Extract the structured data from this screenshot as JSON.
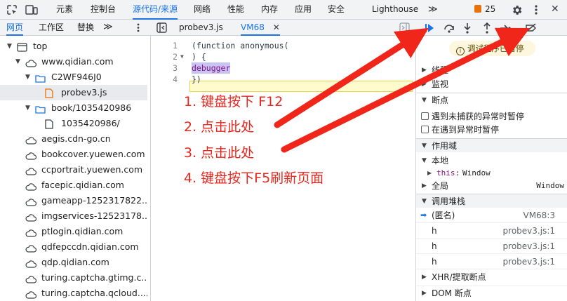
{
  "toolbar": {
    "tabs": [
      "元素",
      "控制台",
      "源代码/来源",
      "网络",
      "性能",
      "内存",
      "应用",
      "安全",
      "Lighthouse"
    ],
    "active_tab": "源代码/来源",
    "more": "≫",
    "issues_count": "25",
    "settings_icon": "gear-icon",
    "menu_icon": "kebab-icon",
    "close": "✕"
  },
  "navigator": {
    "tabs": [
      "网页",
      "工作区",
      "替换"
    ],
    "more": "≫",
    "tree": [
      {
        "label": "top",
        "level": 0,
        "expanded": true,
        "icon": "frame-icon"
      },
      {
        "label": "www.qidian.com",
        "level": 1,
        "expanded": true,
        "icon": "cloud-icon"
      },
      {
        "label": "C2WF946J0",
        "level": 2,
        "expanded": true,
        "icon": "folder-icon"
      },
      {
        "label": "probev3.js",
        "level": 3,
        "icon": "js-file-icon",
        "selected": true
      },
      {
        "label": "book/1035420986",
        "level": 2,
        "expanded": true,
        "icon": "folder-icon"
      },
      {
        "label": "1035420986/",
        "level": 3,
        "icon": "file-icon"
      },
      {
        "label": "aegis.cdn-go.cn",
        "level": 1,
        "icon": "cloud-icon"
      },
      {
        "label": "bookcover.yuewen.com",
        "level": 1,
        "icon": "cloud-icon"
      },
      {
        "label": "ccportrait.yuewen.com",
        "level": 1,
        "icon": "cloud-icon"
      },
      {
        "label": "facepic.qidian.com",
        "level": 1,
        "icon": "cloud-icon"
      },
      {
        "label": "gameapp-1252317822....",
        "level": 1,
        "icon": "cloud-icon"
      },
      {
        "label": "imgservices-12523178...",
        "level": 1,
        "icon": "cloud-icon"
      },
      {
        "label": "ptlogin.qidian.com",
        "level": 1,
        "icon": "cloud-icon"
      },
      {
        "label": "qdfepccdn.qidian.com",
        "level": 1,
        "icon": "cloud-icon"
      },
      {
        "label": "qdp.qidian.com",
        "level": 1,
        "icon": "cloud-icon"
      },
      {
        "label": "turing.captcha.gtimg.c...",
        "level": 1,
        "icon": "cloud-icon"
      },
      {
        "label": "turing.captcha.qcloud....",
        "level": 1,
        "icon": "cloud-icon"
      }
    ]
  },
  "editor": {
    "tabs": [
      {
        "label": "probev3.js",
        "active": false
      },
      {
        "label": "VM68",
        "active": true,
        "closable": true
      }
    ],
    "lines": [
      {
        "num": "1",
        "text": "(function anonymous("
      },
      {
        "num": "2",
        "text": ") {"
      },
      {
        "num": "3",
        "text": "debugger"
      },
      {
        "num": "4",
        "text": "})"
      }
    ],
    "instructions": [
      "1. 键盘按下 F12",
      "2. 点击此处",
      "3. 点击此处",
      "4. 键盘按下F5刷新页面"
    ]
  },
  "debugger": {
    "paused_text": "调试程序已暂停",
    "sections": {
      "threads": "线程",
      "watch": "监视",
      "breakpoints": "断点",
      "pause_uncaught": "遇到未捕获的异常时暂停",
      "pause_caught": "在遇到异常时暂停",
      "scope": "作用域",
      "local": "本地",
      "this_key": "this",
      "this_val": "Window",
      "global": "全局",
      "global_val": "Window",
      "call_stack": "调用堆栈",
      "xhr": "XHR/提取断点",
      "dom": "DOM 断点"
    },
    "call_stack": [
      {
        "fn": "(匿名)",
        "loc": "VM68:3",
        "current": true
      },
      {
        "fn": "h",
        "loc": "probev3.js:1"
      },
      {
        "fn": "h",
        "loc": "probev3.js:1"
      },
      {
        "fn": "h",
        "loc": "probev3.js:1"
      }
    ]
  },
  "colors": {
    "accent": "#1a73e8",
    "annotation_red": "#e8261c",
    "paused_bg": "#fef7e0"
  }
}
